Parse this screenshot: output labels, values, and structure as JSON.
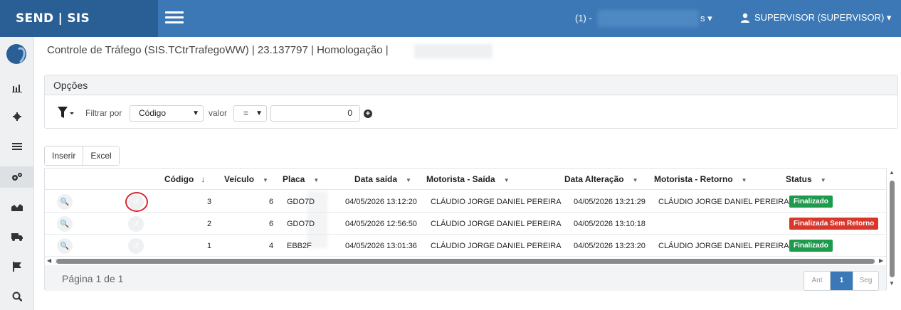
{
  "header": {
    "brand": "SEND | SIS",
    "environment_prefix": "(1) -",
    "environment_caret": "s ▾",
    "user_label": "SUPERVISOR (SUPERVISOR) ▾"
  },
  "sidebar": {
    "items": [
      {
        "name": "dashboard-icon",
        "glyph": "📊"
      },
      {
        "name": "gear-icon",
        "glyph": "⚙"
      },
      {
        "name": "list-icon",
        "glyph": "☰"
      },
      {
        "name": "gears-icon",
        "glyph": "⚙"
      },
      {
        "name": "area-chart-icon",
        "glyph": "▲"
      },
      {
        "name": "truck-icon",
        "glyph": "🚚"
      },
      {
        "name": "flag-icon",
        "glyph": "⚑"
      },
      {
        "name": "search-icon",
        "glyph": "🔍"
      }
    ]
  },
  "page": {
    "title": "Controle de Tráfego (SIS.TCtrTrafegoWW) | 23.137797 | Homologação |"
  },
  "options": {
    "title": "Opções",
    "filter_label": "Filtrar por",
    "field_value": "Código",
    "value_label": "valor",
    "operator_value": "=",
    "input_value": "0"
  },
  "toolbar": {
    "insert_label": "Inserir",
    "excel_label": "Excel"
  },
  "table": {
    "columns": {
      "codigo": "Código",
      "veiculo": "Veículo",
      "placa": "Placa",
      "data_saida": "Data saída",
      "motorista_saida": "Motorista - Saída",
      "data_alteracao": "Data Alteração",
      "motorista_retorno": "Motorista - Retorno",
      "status": "Status"
    },
    "rows": [
      {
        "codigo": "3",
        "veiculo": "6",
        "placa": "GDO7D",
        "data_saida": "04/05/2026 13:12:20",
        "motorista_saida": "CLÁUDIO JORGE DANIEL PEREIRA",
        "data_alteracao": "04/05/2026 13:21:29",
        "motorista_retorno": "CLÁUDIO JORGE DANIEL PEREIRA",
        "status": "Finalizado"
      },
      {
        "codigo": "2",
        "veiculo": "6",
        "placa": "GDO7D",
        "data_saida": "04/05/2026 12:56:50",
        "motorista_saida": "CLÁUDIO JORGE DANIEL PEREIRA",
        "data_alteracao": "04/05/2026 13:10:18",
        "motorista_retorno": "",
        "status": "Finalizada Sem Retorno"
      },
      {
        "codigo": "1",
        "veiculo": "4",
        "placa": "EBB2F",
        "data_saida": "04/05/2026 13:01:36",
        "motorista_saida": "CLÁUDIO JORGE DANIEL PEREIRA",
        "data_alteracao": "04/05/2026 13:23:20",
        "motorista_retorno": "CLÁUDIO JORGE DANIEL PEREIRA",
        "status": "Finalizado"
      }
    ]
  },
  "pagination": {
    "info": "Página 1 de 1",
    "prev": "Ant",
    "current": "1",
    "next": "Seg"
  },
  "colors": {
    "topbar": "#3c78b5",
    "brand_bg": "#2a5f95",
    "status_ok": "#1e9a4c",
    "status_warn": "#d9362c",
    "highlight": "#d9262d"
  }
}
